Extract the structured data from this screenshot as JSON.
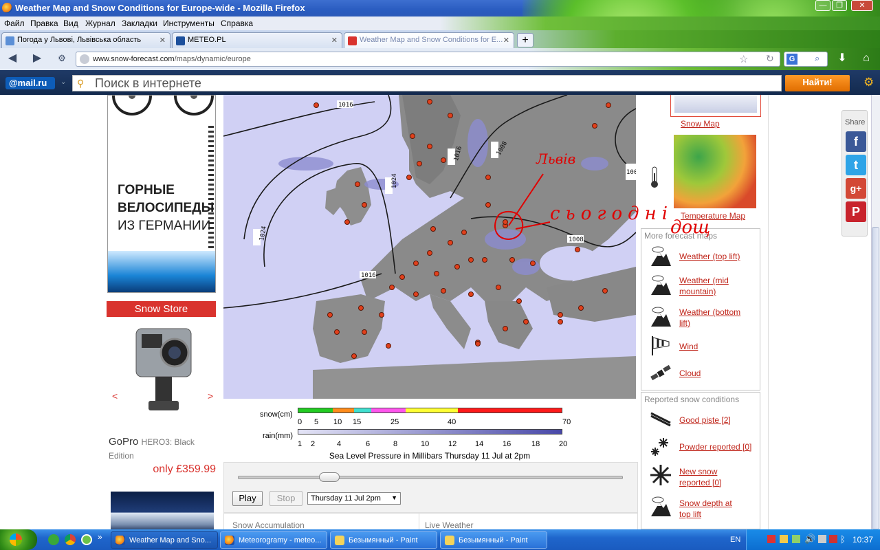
{
  "window": {
    "title": "Weather Map and Snow Conditions for Europe-wide - Mozilla Firefox",
    "controls": [
      "—",
      "❐",
      "✕"
    ]
  },
  "menu": [
    "Файл",
    "Правка",
    "Вид",
    "Журнал",
    "Закладки",
    "Инструменты",
    "Справка"
  ],
  "tabs": [
    {
      "label": "Погода у Львові, Львівська область",
      "active": false
    },
    {
      "label": "METEO.PL",
      "active": false
    },
    {
      "label": "Weather Map and Snow Conditions for E...",
      "active": true
    }
  ],
  "tab_close": "✕",
  "new_tab": "+",
  "nav": {
    "url_domain": "www.snow-forecast.com",
    "url_path": "/maps/dynamic/europe",
    "search_engine": "G"
  },
  "mailbar": {
    "logo": "@mail.ru",
    "search_placeholder": "Поиск в интернете",
    "find_button": "Найти!"
  },
  "left_ads": {
    "bike_text": [
      "ГОРНЫЕ",
      "ВЕЛОСИПЕДЫ",
      "ИЗ ГЕРМАНИИ"
    ],
    "snow_store": "Snow Store",
    "prev": "<",
    "next": ">",
    "product_brand": "GoPro",
    "product_model": "HERO3: Black Edition",
    "price": "only £359.99"
  },
  "map": {
    "isobar_labels": [
      "1016",
      "1024",
      "1024",
      "1016",
      "1008",
      "1016",
      "1008",
      "1008"
    ],
    "annotation_city": "Львів",
    "annotation_note_1": "сьогодні",
    "annotation_note_2": "дощ"
  },
  "right_panel": {
    "snow_map": "Snow Map",
    "temperature_map": "Temperature Map",
    "more_title": "More forecast maps",
    "forecast_links": [
      {
        "label": "Weather (top lift)",
        "icon": "mountain-cloud-icon"
      },
      {
        "label": "Weather (mid mountain)",
        "icon": "mountain-cloud-icon"
      },
      {
        "label": "Weather (bottom lift)",
        "icon": "mountain-cloud-icon"
      },
      {
        "label": "Wind",
        "icon": "windsock-icon"
      },
      {
        "label": "Cloud",
        "icon": "satellite-icon"
      }
    ],
    "reported_title": "Reported snow conditions",
    "reported_links": [
      {
        "label": "Good piste [2]",
        "icon": "skis-icon"
      },
      {
        "label": "Powder reported [0]",
        "icon": "snowflakes-icon"
      },
      {
        "label": "New snow reported [0]",
        "icon": "snowflake-icon"
      },
      {
        "label": "Snow depth at top lift",
        "icon": "mountain-cloud-icon"
      }
    ]
  },
  "legend": {
    "snow_label": "snow(cm)",
    "snow_ticks": [
      "0",
      "5",
      "10",
      "15",
      "25",
      "40",
      "70"
    ],
    "snow_colors": [
      "#22cc22",
      "#ff8c1a",
      "#40e0d0",
      "#ff55ee",
      "#ffff33",
      "#ff1a1a"
    ],
    "rain_label": "rain(mm)",
    "rain_ticks": [
      "1",
      "2",
      "4",
      "6",
      "8",
      "10",
      "12",
      "14",
      "16",
      "18",
      "20"
    ],
    "caption": "Sea Level Pressure in Millibars Thursday 11 Jul at 2pm"
  },
  "controls": {
    "play": "Play",
    "stop": "Stop",
    "time_select": "Thursday 11 Jul 2pm",
    "slider_value": 0.22
  },
  "bottom_tabs": [
    "Snow Accumulation",
    "Live Weather"
  ],
  "share": {
    "title": "Share",
    "buttons": [
      {
        "label": "f",
        "color": "#3b5998"
      },
      {
        "label": "t",
        "color": "#2fa4e7"
      },
      {
        "label": "g+",
        "color": "#d34836"
      },
      {
        "label": "P",
        "color": "#c8232c"
      }
    ]
  },
  "taskbar": {
    "tasks": [
      "Weather Map and Sno...",
      "Meteorogramy - meteo...",
      "Безымянный - Paint",
      "Безымянный - Paint"
    ],
    "lang": "EN",
    "clock": "10:37"
  }
}
